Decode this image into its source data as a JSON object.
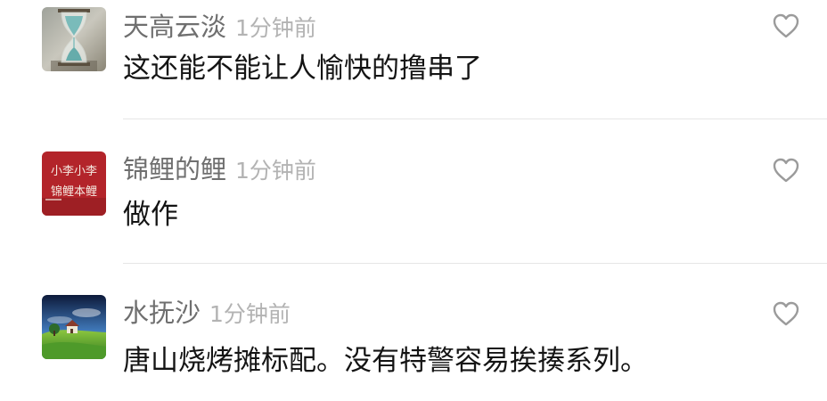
{
  "comments": [
    {
      "username": "天高云淡",
      "time": "1分钟前",
      "text": "这还能不能让人愉快的撸串了",
      "avatar": "hourglass-avatar"
    },
    {
      "username": "锦鲤的鲤",
      "time": "1分钟前",
      "text": "做作",
      "avatar": "red-calligraphy-avatar",
      "avatar_text": [
        "小李小李",
        "锦鲤本鲤"
      ]
    },
    {
      "username": "水抚沙",
      "time": "1分钟前",
      "text": "唐山烧烤摊标配。没有特警容易挨揍系列。",
      "avatar": "landscape-avatar"
    }
  ],
  "colors": {
    "username": "#6f6f6f",
    "time": "#b3b3b3",
    "content": "#141414",
    "like_icon": "#9b9b9b",
    "divider": "#e6e6e6"
  },
  "icons": {
    "like": "heart-outline-icon"
  }
}
